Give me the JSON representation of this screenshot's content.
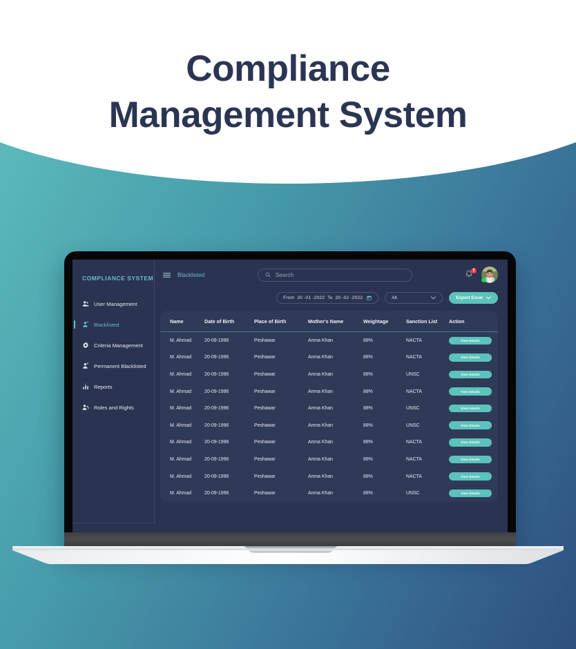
{
  "hero": {
    "title_line1": "Compliance",
    "title_line2": "Management System",
    "title_color": "#2b3553"
  },
  "theme": {
    "accent": "#5cc2bc",
    "accent_text": "#69bfc0",
    "screen_bg": "#2a3350",
    "card_bg": "#2f3a57",
    "badge_red": "#ef3e4a",
    "online_green": "#22d24a",
    "bg_gradient_from": "#63c2c0",
    "bg_gradient_to": "#2e4f7e"
  },
  "sidebar": {
    "brand": "COMPLIANCE SYSTEM",
    "items": [
      {
        "label": "User Management",
        "icon": "users-icon",
        "active": false
      },
      {
        "label": "Blacklisted",
        "icon": "user-block-icon",
        "active": true
      },
      {
        "label": "Criteria Management",
        "icon": "gear-icon",
        "active": false
      },
      {
        "label": "Permanent Blacklisted",
        "icon": "user-block-icon",
        "active": false
      },
      {
        "label": "Reports",
        "icon": "bar-chart-icon",
        "active": false
      },
      {
        "label": "Roles and Rights",
        "icon": "user-add-icon",
        "active": false
      }
    ]
  },
  "topbar": {
    "menu_icon": "hamburger-icon",
    "breadcrumb": "Blacklisted",
    "search": {
      "icon": "search-icon",
      "placeholder": "Search",
      "value": ""
    },
    "notifications": {
      "icon": "bell-icon",
      "count": "5"
    },
    "avatar": {
      "icon": "avatar",
      "status": "online"
    }
  },
  "filters": {
    "date_range": {
      "from_label": "From",
      "from_value": "20 -01 -2022",
      "to_label": "To",
      "to_value": "20 -02 -2022",
      "icon": "calendar-icon"
    },
    "list_select": {
      "value": "All",
      "icon": "chevron-down-icon"
    },
    "export_button": {
      "label": "Export Excel",
      "icon": "chevron-down-icon"
    }
  },
  "table": {
    "columns": [
      "Name",
      "Date of Birth",
      "Place of Birth",
      "Mother's Name",
      "Weightage",
      "Sanction List",
      "Action"
    ],
    "action_label": "View Details",
    "rows": [
      {
        "name": "M. Ahmad",
        "dob": "20-09-1996",
        "pob": "Peshawar",
        "mother": "Amna Khan",
        "weightage": "88%",
        "sanction": "NACTA"
      },
      {
        "name": "M. Ahmad",
        "dob": "20-09-1996",
        "pob": "Peshawar",
        "mother": "Amna Khan",
        "weightage": "88%",
        "sanction": "NACTA"
      },
      {
        "name": "M. Ahmad",
        "dob": "20-09-1996",
        "pob": "Peshawar",
        "mother": "Amna Khan",
        "weightage": "88%",
        "sanction": "UNSC"
      },
      {
        "name": "M. Ahmad",
        "dob": "20-09-1996",
        "pob": "Peshawar",
        "mother": "Amna Khan",
        "weightage": "88%",
        "sanction": "NACTA"
      },
      {
        "name": "M. Ahmad",
        "dob": "20-09-1996",
        "pob": "Peshawar",
        "mother": "Amna Khan",
        "weightage": "88%",
        "sanction": "UNSC"
      },
      {
        "name": "M. Ahmad",
        "dob": "20-09-1996",
        "pob": "Peshawar",
        "mother": "Amna Khan",
        "weightage": "88%",
        "sanction": "UNSC"
      },
      {
        "name": "M. Ahmad",
        "dob": "20-09-1996",
        "pob": "Peshawar",
        "mother": "Amna Khan",
        "weightage": "88%",
        "sanction": "NACTA"
      },
      {
        "name": "M. Ahmad",
        "dob": "20-09-1996",
        "pob": "Peshawar",
        "mother": "Amna Khan",
        "weightage": "88%",
        "sanction": "NACTA"
      },
      {
        "name": "M. Ahmad",
        "dob": "20-09-1996",
        "pob": "Peshawar",
        "mother": "Amna Khan",
        "weightage": "88%",
        "sanction": "NACTA"
      },
      {
        "name": "M. Ahmad",
        "dob": "20-09-1996",
        "pob": "Peshawar",
        "mother": "Amna Khan",
        "weightage": "88%",
        "sanction": "UNSC"
      }
    ]
  }
}
